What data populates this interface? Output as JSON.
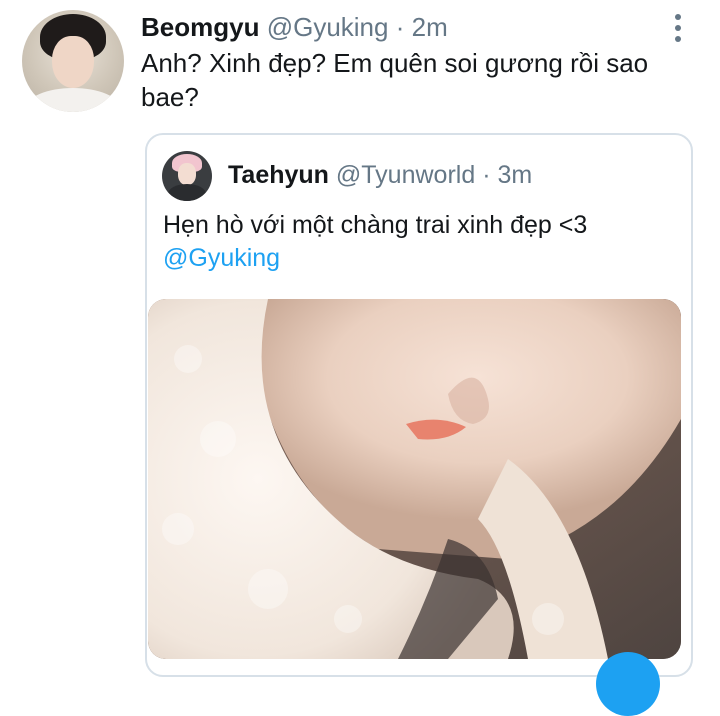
{
  "tweet": {
    "author_name": "Beomgyu",
    "author_handle": "@Gyuking",
    "separator": "·",
    "time": "2m",
    "text": "Anh? Xinh đẹp? Em quên soi gương rồi sao bae?",
    "more_icon": "more-vertical-icon"
  },
  "quoted_tweet": {
    "author_name": "Taehyun",
    "author_handle": "@Tyunworld",
    "separator": "·",
    "time": "3m",
    "text": "Hẹn hò với một chàng trai xinh đẹp <3",
    "mention": "@Gyuking"
  },
  "colors": {
    "text_primary": "#14171a",
    "text_secondary": "#657786",
    "link": "#1da1f2",
    "border": "#d7e0e8"
  }
}
